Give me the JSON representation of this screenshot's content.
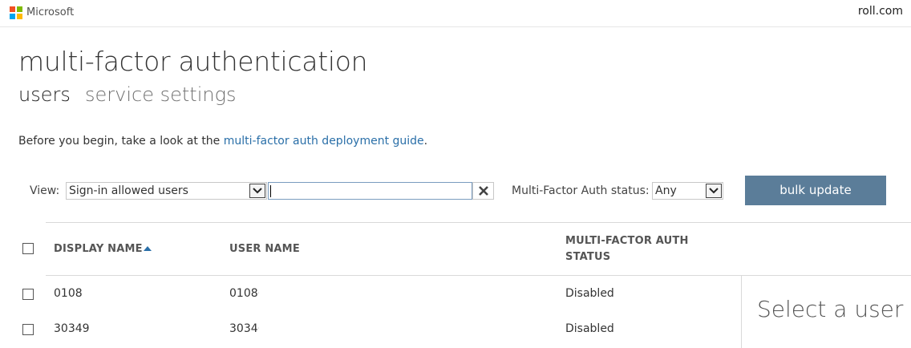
{
  "brand": {
    "name": "Microsoft",
    "tenant": "roll.com"
  },
  "page": {
    "title": "multi-factor authentication"
  },
  "tabs": [
    {
      "label": "users",
      "active": true
    },
    {
      "label": "service settings",
      "active": false
    }
  ],
  "intro": {
    "text": "Before you begin, take a look at the ",
    "link": "multi-factor auth deployment guide",
    "suffix": "."
  },
  "filters": {
    "view_label": "View:",
    "view_value": "Sign-in allowed users",
    "search_value": "",
    "status_label": "Multi-Factor Auth status:",
    "status_value": "Any",
    "bulk_label": "bulk update"
  },
  "table": {
    "columns": [
      "DISPLAY NAME",
      "USER NAME",
      "MULTI-FACTOR AUTH",
      "STATUS"
    ],
    "sort": {
      "column": "DISPLAY NAME",
      "direction": "ascending"
    },
    "rows": [
      {
        "display_name": "0108",
        "user_name": "0108(",
        "status": "Disabled"
      },
      {
        "display_name": "30349",
        "user_name": "3034(",
        "status": "Disabled"
      }
    ]
  },
  "detail": {
    "placeholder": "Select a user"
  },
  "colors": {
    "accent": "#5b7d99",
    "link": "#2a6fa8",
    "ms_red": "#f25022",
    "ms_green": "#7fba00",
    "ms_blue": "#00a4ef",
    "ms_yellow": "#ffb900"
  },
  "icons": [
    "microsoft-logo-icon",
    "chevron-down-icon",
    "close-icon",
    "sort-ascending-icon",
    "checkbox-icon"
  ]
}
